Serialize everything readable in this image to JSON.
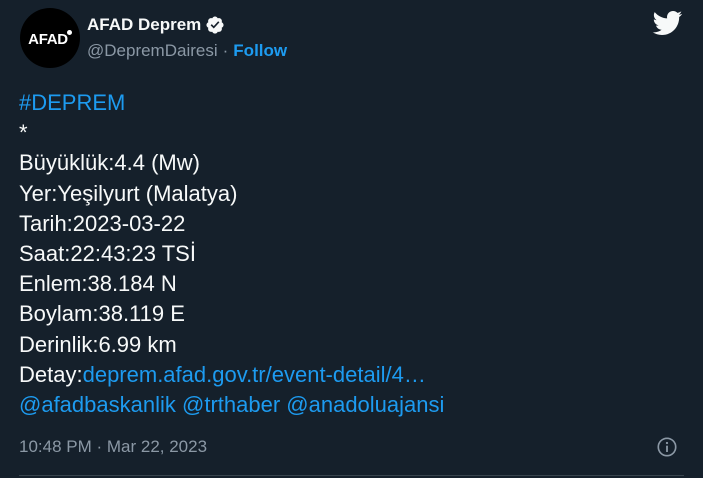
{
  "account": {
    "avatar_text": "AFAD",
    "display_name": "AFAD Deprem",
    "handle": "@DepremDairesi",
    "separator": "·",
    "follow_label": "Follow"
  },
  "tweet": {
    "hashtag": "#DEPREM",
    "asterisk": "*",
    "magnitude": "Büyüklük:4.4 (Mw)",
    "location": "Yer:Yeşilyurt (Malatya)",
    "date": "Tarih:2023-03-22",
    "time": "Saat:22:43:23 TSİ",
    "latitude": "Enlem:38.184 N",
    "longitude": "Boylam:38.119 E",
    "depth": "Derinlik:6.99 km",
    "detail_prefix": "Detay:",
    "detail_link": "deprem.afad.gov.tr/event-detail/4…",
    "mentions": [
      "@afadbaskanlik",
      "@trthaber",
      "@anadoluajansi"
    ]
  },
  "footer": {
    "timestamp": "10:48 PM · Mar 22, 2023"
  },
  "icons": {
    "verified": "verified-badge-icon",
    "platform": "twitter-bird-icon",
    "info": "info-icon"
  },
  "colors": {
    "background": "#15202b",
    "text": "#f7f9f9",
    "muted": "#8b98a5",
    "link": "#1d9bf0"
  }
}
